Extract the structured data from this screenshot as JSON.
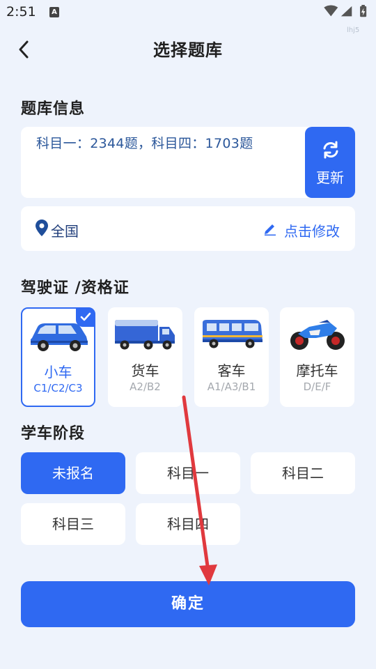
{
  "status_bar": {
    "time": "2:51",
    "notification_icon": "A",
    "watermark": "lhj5"
  },
  "header": {
    "title": "选择题库",
    "back_icon": "chevron-left-icon"
  },
  "question_bank_info": {
    "section_title": "题库信息",
    "summary": "科目一：2344题，科目四：1703题",
    "update_label": "更新"
  },
  "region": {
    "value": "全国",
    "edit_label": "点击修改"
  },
  "license": {
    "section_title": "驾驶证 /资格证",
    "options": [
      {
        "name": "小车",
        "code": "C1/C2/C3",
        "selected": true
      },
      {
        "name": "货车",
        "code": "A2/B2",
        "selected": false
      },
      {
        "name": "客车",
        "code": "A1/A3/B1",
        "selected": false
      },
      {
        "name": "摩托车",
        "code": "D/E/F",
        "selected": false
      }
    ]
  },
  "stage": {
    "section_title": "学车阶段",
    "options": [
      {
        "label": "未报名",
        "active": true
      },
      {
        "label": "科目一",
        "active": false
      },
      {
        "label": "科目二",
        "active": false
      },
      {
        "label": "科目三",
        "active": false
      },
      {
        "label": "科目四",
        "active": false
      }
    ]
  },
  "confirm_label": "确定",
  "colors": {
    "accent": "#2f69f2",
    "background": "#eef3fc",
    "annotation_arrow": "#e0393e"
  }
}
